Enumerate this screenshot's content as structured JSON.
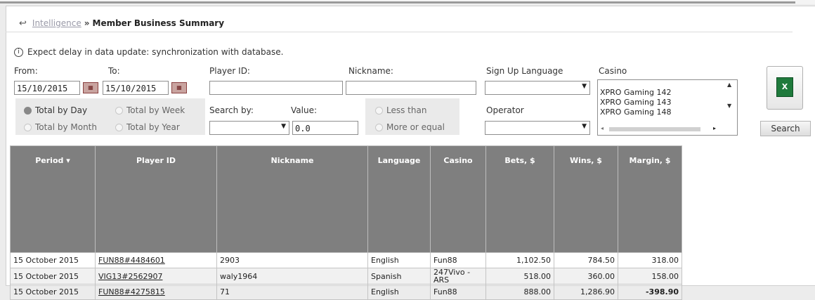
{
  "breadcrumb": {
    "parent": "Intelligence",
    "separator": "»",
    "current": "Member Business Summary"
  },
  "notice": "Expect delay in data update: synchronization with database.",
  "filters": {
    "from_label": "From:",
    "from_value": "15/10/2015",
    "to_label": "To:",
    "to_value": "15/10/2015",
    "player_id_label": "Player ID:",
    "player_id_value": "",
    "nickname_label": "Nickname:",
    "nickname_value": "",
    "signup_language_label": "Sign Up Language",
    "signup_language_value": "",
    "casino_label": "Casino",
    "casino_options": [
      "XPRO Gaming 142",
      "XPRO Gaming 143",
      "XPRO Gaming 148"
    ],
    "totals": [
      "Total by Day",
      "Total by Week",
      "Total by Month",
      "Total by Year"
    ],
    "totals_selected": "Total by Day",
    "search_by_label": "Search by:",
    "search_by_value": "",
    "value_label": "Value:",
    "value_value": "0.0",
    "less_than": "Less than",
    "more_or_equal": "More or equal",
    "operator_label": "Operator",
    "operator_value": ""
  },
  "search_button": "Search",
  "export_icon": "excel-icon",
  "table": {
    "columns": [
      "Period",
      "Player ID",
      "Nickname",
      "Language",
      "Casino",
      "Bets, $",
      "Wins, $",
      "Margin, $"
    ],
    "rows": [
      [
        "15 October 2015",
        "FUN88#4484601",
        "2903",
        "English",
        "Fun88",
        "1,102.50",
        "784.50",
        "318.00"
      ],
      [
        "15 October 2015",
        "VIG13#2562907",
        "waly1964",
        "Spanish",
        "247Vivo - ARS",
        "518.00",
        "360.00",
        "158.00"
      ],
      [
        "15 October 2015",
        "FUN88#4275815",
        "71",
        "English",
        "Fun88",
        "888.00",
        "1,286.90",
        "-398.90"
      ]
    ]
  },
  "colors": {
    "header_bg": "#7f7f7f",
    "negative": "#d93030"
  }
}
